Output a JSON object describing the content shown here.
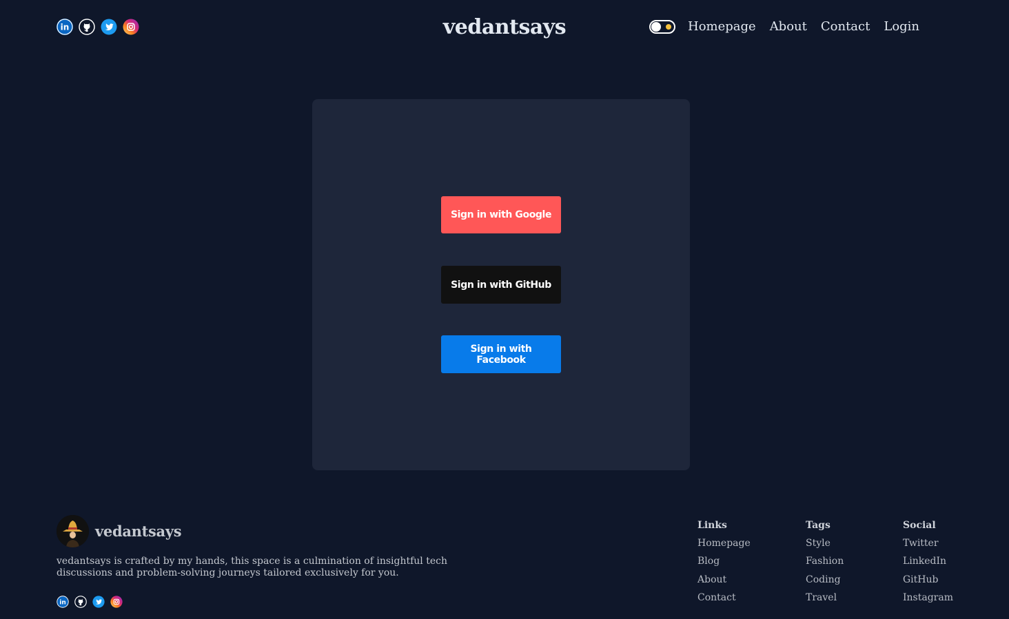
{
  "header": {
    "brand": "vedantsays",
    "social_icons": [
      "linkedin-icon",
      "github-icon",
      "twitter-icon",
      "instagram-icon"
    ],
    "theme_toggle": {
      "state": "dark"
    },
    "nav": [
      {
        "label": "Homepage"
      },
      {
        "label": "About"
      },
      {
        "label": "Contact"
      },
      {
        "label": "Login"
      }
    ]
  },
  "login": {
    "google_label": "Sign in with Google",
    "github_label": "Sign in with GitHub",
    "facebook_label": "Sign in with Facebook"
  },
  "footer": {
    "brand": "vedantsays",
    "description": "vedantsays is crafted by my hands, this space is a culmination of insightful tech discussions and problem-solving journeys tailored exclusively for you.",
    "columns": [
      {
        "heading": "Links",
        "items": [
          "Homepage",
          "Blog",
          "About",
          "Contact"
        ]
      },
      {
        "heading": "Tags",
        "items": [
          "Style",
          "Fashion",
          "Coding",
          "Travel"
        ]
      },
      {
        "heading": "Social",
        "items": [
          "Twitter",
          "LinkedIn",
          "GitHub",
          "Instagram"
        ]
      }
    ]
  },
  "colors": {
    "background": "#0f172a",
    "card": "#1e263a",
    "google": "#ff5757",
    "github": "#111111",
    "facebook": "#087bea",
    "toggle_sun": "#f6c23e"
  }
}
